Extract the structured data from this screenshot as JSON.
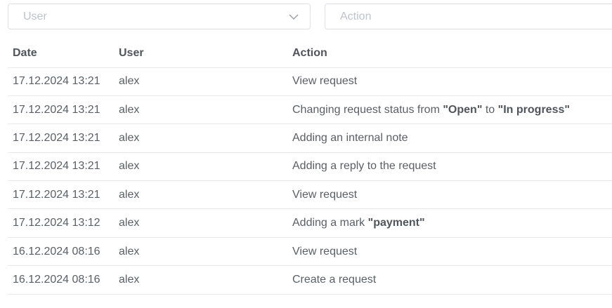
{
  "filters": {
    "user_placeholder": "User",
    "action_placeholder": "Action",
    "user_icon": "chevron-down-icon"
  },
  "table": {
    "headers": {
      "date": "Date",
      "user": "User",
      "action": "Action"
    },
    "rows": [
      {
        "date": "17.12.2024 13:21",
        "user": "alex",
        "action": [
          {
            "t": "View request",
            "b": false
          }
        ]
      },
      {
        "date": "17.12.2024 13:21",
        "user": "alex",
        "action": [
          {
            "t": "Changing request status from ",
            "b": false
          },
          {
            "t": "\"Open\"",
            "b": true
          },
          {
            "t": " to ",
            "b": false
          },
          {
            "t": "\"In progress\"",
            "b": true
          }
        ]
      },
      {
        "date": "17.12.2024 13:21",
        "user": "alex",
        "action": [
          {
            "t": "Adding an internal note",
            "b": false
          }
        ]
      },
      {
        "date": "17.12.2024 13:21",
        "user": "alex",
        "action": [
          {
            "t": "Adding a reply to the request",
            "b": false
          }
        ]
      },
      {
        "date": "17.12.2024 13:21",
        "user": "alex",
        "action": [
          {
            "t": "View request",
            "b": false
          }
        ]
      },
      {
        "date": "17.12.2024 13:12",
        "user": "alex",
        "action": [
          {
            "t": "Adding a mark ",
            "b": false
          },
          {
            "t": "\"payment\"",
            "b": true
          }
        ]
      },
      {
        "date": "16.12.2024 08:16",
        "user": "alex",
        "action": [
          {
            "t": "View request",
            "b": false
          }
        ]
      },
      {
        "date": "16.12.2024 08:16",
        "user": "alex",
        "action": [
          {
            "t": "Create a request",
            "b": false
          }
        ]
      }
    ]
  }
}
